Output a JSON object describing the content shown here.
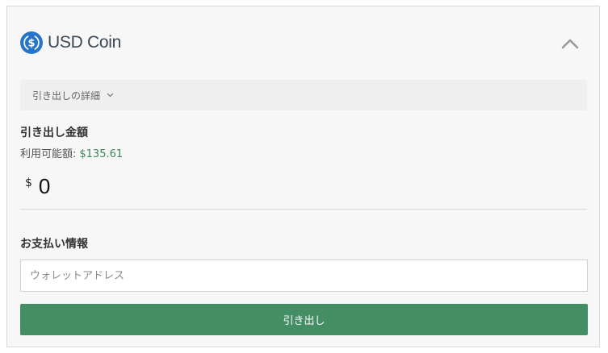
{
  "header": {
    "coin_name": "USD Coin",
    "logo_icon": "usdc-logo-icon",
    "collapse_icon": "chevron-up-icon"
  },
  "details": {
    "label": "引き出しの詳細",
    "chevron_icon": "chevron-down-icon"
  },
  "amount": {
    "title": "引き出し金額",
    "available_label": "利用可能額:",
    "available_value": "$135.61",
    "currency_symbol": "$",
    "value": "0"
  },
  "payment": {
    "title": "お支払い情報",
    "wallet_placeholder": "ウォレットアドレス",
    "wallet_value": ""
  },
  "actions": {
    "withdraw_label": "引き出し"
  },
  "colors": {
    "brand_usdc": "#2775ca",
    "accent_green": "#448e65",
    "available_green": "#3b8a5a"
  }
}
